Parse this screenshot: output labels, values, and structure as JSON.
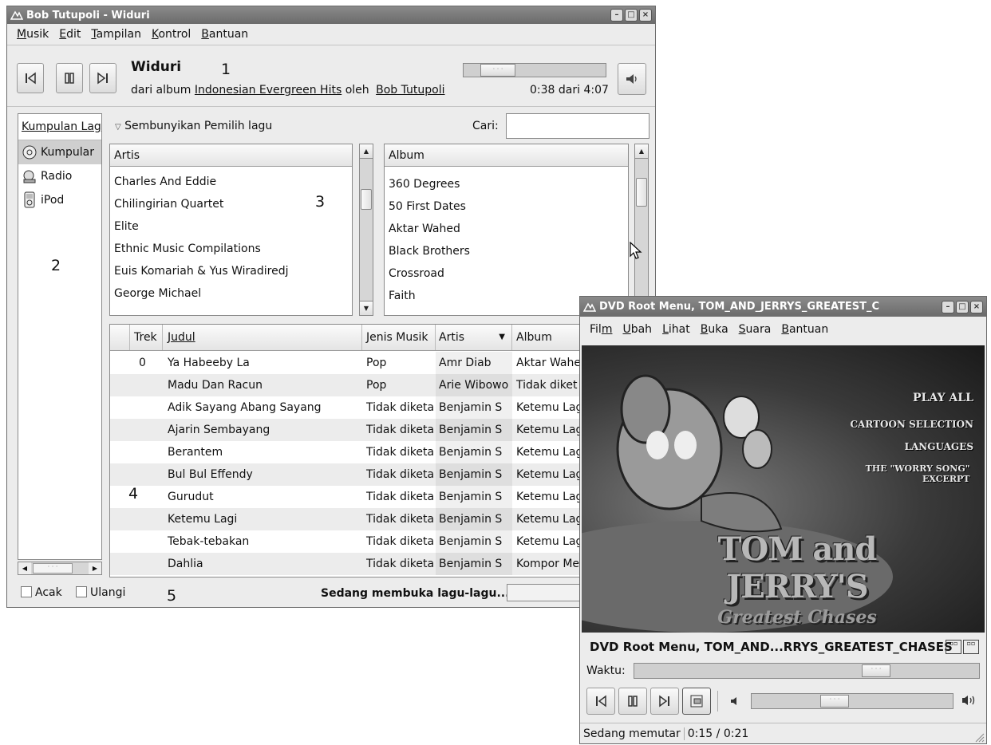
{
  "rhythmbox": {
    "title": "Bob Tutupoli - Widuri",
    "menu": [
      {
        "u": "M",
        "rest": "usik"
      },
      {
        "u": "E",
        "rest": "dit"
      },
      {
        "u": "T",
        "rest": "ampilan"
      },
      {
        "u": "K",
        "rest": "ontrol"
      },
      {
        "u": "B",
        "rest": "antuan"
      }
    ],
    "song_title": "Widuri",
    "from_album": "dari album",
    "album_link": "Indonesian Evergreen Hits",
    "by": "oleh",
    "artist_link": "Bob Tutupoli",
    "time": "0:38 dari 4:07",
    "progress": 0.16,
    "sidebar": {
      "header": "Kumpulan Lag",
      "items": [
        "Kumpular",
        "Radio",
        "iPod"
      ]
    },
    "hide_browser": "Sembunyikan Pemilih lagu",
    "search_label": "Cari:",
    "search_value": "",
    "artist_header": "Artis",
    "artists": [
      "Charles And Eddie",
      "Chilingirian Quartet",
      "Elite",
      "Ethnic Music Compilations",
      "Euis Komariah & Yus Wiradiredj",
      "George Michael"
    ],
    "album_header": "Album",
    "albums": [
      "360 Degrees",
      "50 First Dates",
      "Aktar Wahed",
      "Black Brothers",
      "Crossroad",
      "Faith"
    ],
    "columns": [
      "Trek",
      "Judul",
      "Jenis Musik",
      "Artis",
      "Album"
    ],
    "tracks": [
      {
        "no": "0",
        "title": "Ya Habeeby La",
        "genre": "Pop",
        "artist": "Amr Diab",
        "album": "Aktar Wahe"
      },
      {
        "no": "",
        "title": "Madu Dan Racun",
        "genre": "Pop",
        "artist": "Arie Wibowo",
        "album": "Tidak diket"
      },
      {
        "no": "",
        "title": "Adik Sayang Abang Sayang",
        "genre": "Tidak diketa",
        "artist": "Benjamin S",
        "album": "Ketemu Lag"
      },
      {
        "no": "",
        "title": "Ajarin Sembayang",
        "genre": "Tidak diketa",
        "artist": "Benjamin S",
        "album": "Ketemu Lag"
      },
      {
        "no": "",
        "title": "Berantem",
        "genre": "Tidak diketa",
        "artist": "Benjamin S",
        "album": "Ketemu Lag"
      },
      {
        "no": "",
        "title": "Bul Bul Effendy",
        "genre": "Tidak diketa",
        "artist": "Benjamin S",
        "album": "Ketemu Lag"
      },
      {
        "no": "",
        "title": "Gurudut",
        "genre": "Tidak diketa",
        "artist": "Benjamin S",
        "album": "Ketemu Lag"
      },
      {
        "no": "",
        "title": "Ketemu Lagi",
        "genre": "Tidak diketa",
        "artist": "Benjamin S",
        "album": "Ketemu Lag"
      },
      {
        "no": "",
        "title": "Tebak-tebakan",
        "genre": "Tidak diketa",
        "artist": "Benjamin S",
        "album": "Ketemu Lag"
      },
      {
        "no": "",
        "title": "Dahlia",
        "genre": "Tidak diketa",
        "artist": "Benjamin S",
        "album": "Kompor Me"
      }
    ],
    "shuffle": "Acak",
    "repeat": "Ulangi",
    "status": "Sedang membuka lagu-lagu...",
    "annotations": [
      "1",
      "2",
      "3",
      "4",
      "5"
    ]
  },
  "totem": {
    "title": "DVD Root Menu, TOM_AND_JERRYS_GREATEST_C",
    "menu": [
      {
        "pre": "Fil",
        "u": "m",
        "rest": ""
      },
      {
        "pre": "",
        "u": "U",
        "rest": "bah"
      },
      {
        "pre": "",
        "u": "L",
        "rest": "ihat"
      },
      {
        "pre": "",
        "u": "B",
        "rest": "uka"
      },
      {
        "pre": "",
        "u": "S",
        "rest": "uara"
      },
      {
        "pre": "",
        "u": "B",
        "rest": "antuan"
      }
    ],
    "video_menu": [
      "PLAY ALL",
      "CARTOON SELECTION",
      "LANGUAGES",
      "THE \"WORRY SONG\" EXCERPT"
    ],
    "logo_line1": "TOM and JERRY'S",
    "logo_line2": "Greatest Chases",
    "now_playing": "DVD Root Menu, TOM_AND...RRYS_GREATEST_CHASES",
    "time_label": "Waktu:",
    "seek": 0.72,
    "volume": 0.4,
    "status": "Sedang memutar",
    "time": "0:15 / 0:21"
  },
  "colors": {
    "titlebar": "#6b6b6b",
    "window": "#ececec",
    "highlight": "#dcdcdc"
  }
}
